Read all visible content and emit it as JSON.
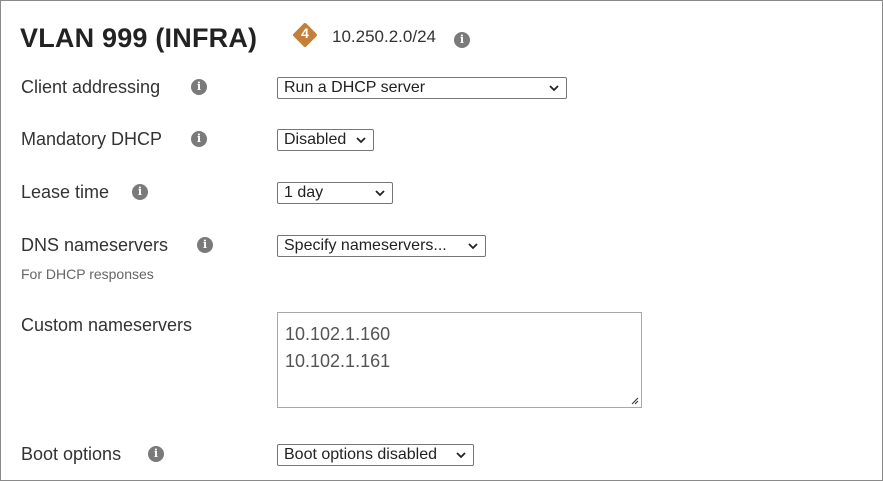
{
  "header": {
    "title": "VLAN 999 (INFRA)",
    "badge": "4",
    "badge_color": "#c47f3a",
    "subnet": "10.250.2.0/24",
    "subnet_info_icon": "info-icon"
  },
  "fields": {
    "client_addressing": {
      "label": "Client addressing",
      "value": "Run a DHCP server"
    },
    "mandatory_dhcp": {
      "label": "Mandatory DHCP",
      "value": "Disabled"
    },
    "lease_time": {
      "label": "Lease time",
      "value": "1 day"
    },
    "dns_nameservers": {
      "label": "DNS nameservers",
      "sublabel": "For DHCP responses",
      "value": "Specify nameservers..."
    },
    "custom_nameservers": {
      "label": "Custom nameservers",
      "lines": [
        "10.102.1.160",
        "10.102.1.161"
      ]
    },
    "boot_options": {
      "label": "Boot options",
      "value": "Boot options disabled"
    }
  },
  "icons": {
    "info": "info-icon",
    "dropdown": "chevron-down-icon",
    "resize": "resize-handle-icon"
  }
}
